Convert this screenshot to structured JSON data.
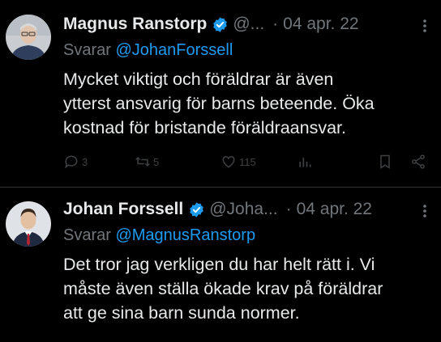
{
  "tweets": [
    {
      "author_name": "Magnus Ranstorp",
      "author_handle": "@...",
      "separator": "·",
      "date": "04 apr. 22",
      "reply_prefix": "Svarar",
      "reply_to": "@JohanForssell",
      "text_lines": [
        "Mycket viktigt och föräldrar är även",
        "ytterst ansvarig för barns beteende. Öka",
        "kostnad för bristande föräldraansvar."
      ],
      "metrics": {
        "replies": "3",
        "retweets": "5",
        "likes": "115"
      }
    },
    {
      "author_name": "Johan Forssell",
      "author_handle": "@Joha...",
      "separator": "·",
      "date": "04 apr. 22",
      "reply_prefix": "Svarar",
      "reply_to": "@MagnusRanstorp",
      "text_lines": [
        "Det tror jag verkligen du har helt rätt i. Vi",
        "måste även ställa ökade krav på föräldrar",
        "att ge sina barn sunda normer."
      ]
    }
  ],
  "colors": {
    "background": "#000000",
    "text": "#e7e9ea",
    "secondary": "#71767b",
    "link": "#1d9bf0",
    "verified": "#1d9bf0",
    "divider": "#2f3336"
  },
  "icons": [
    "verified-badge-icon",
    "more-icon",
    "reply-icon",
    "retweet-icon",
    "like-icon",
    "views-icon",
    "bookmark-icon",
    "share-icon"
  ]
}
